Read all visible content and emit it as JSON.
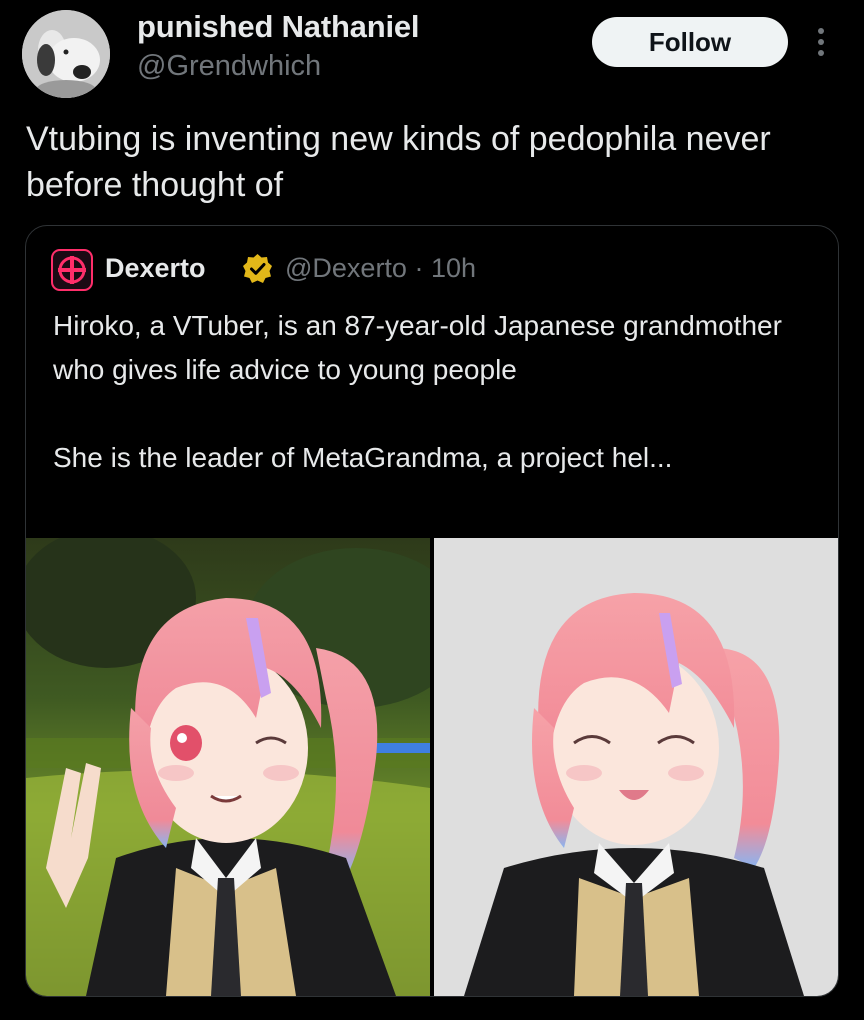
{
  "author": {
    "display_name": "punished Nathaniel",
    "handle": "@Grendwhich",
    "avatar_icon": "snoopy-avatar"
  },
  "actions": {
    "follow_label": "Follow",
    "more_icon": "more-vertical-icon"
  },
  "tweet": {
    "text": "Vtubing is inventing new kinds of pedophila never before thought of"
  },
  "quote": {
    "logo_icon": "dexerto-logo",
    "name": "Dexerto",
    "verified_icon": "gold-verified-badge",
    "meta": "@Dexerto · 10h",
    "paragraph1": "Hiroko, a VTuber, is an 87-year-old Japanese grandmother who gives life advice to young people",
    "paragraph2": "She is the leader of MetaGrandma, a project hel...",
    "images": [
      {
        "subject": "anime-avatar-winking-peace-sign"
      },
      {
        "subject": "anime-avatar-smiling-gray-background"
      }
    ]
  },
  "colors": {
    "background": "#000000",
    "text_primary": "#e7e9ea",
    "text_secondary": "#71767b",
    "follow_bg": "#eff3f4",
    "verified_gold": "#e2b719",
    "border": "#2f3336"
  }
}
